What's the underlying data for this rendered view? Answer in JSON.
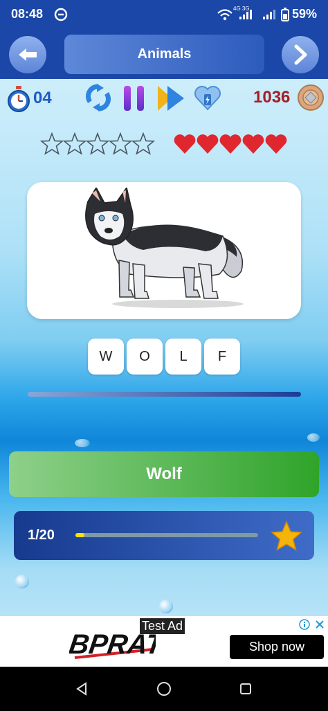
{
  "status": {
    "time": "08:48",
    "network": "4G 3G",
    "battery": "59%"
  },
  "header": {
    "title": "Animals"
  },
  "stats": {
    "timer": "04",
    "coins": "1036"
  },
  "rating": {
    "stars_filled": 0,
    "stars_total": 5,
    "hearts": 5
  },
  "word": {
    "letters": [
      "W",
      "O",
      "L",
      "F"
    ]
  },
  "answer": {
    "label": "Wolf"
  },
  "level": {
    "count": "1/20",
    "progress": 0.05
  },
  "ad": {
    "label": "Test Ad",
    "brand": "BPRATV",
    "cta": "Shop now"
  },
  "colors": {
    "accent": "#1a47a8",
    "answer": "#2fa42a",
    "heart": "#e0262f",
    "star": "#f5b40a"
  }
}
